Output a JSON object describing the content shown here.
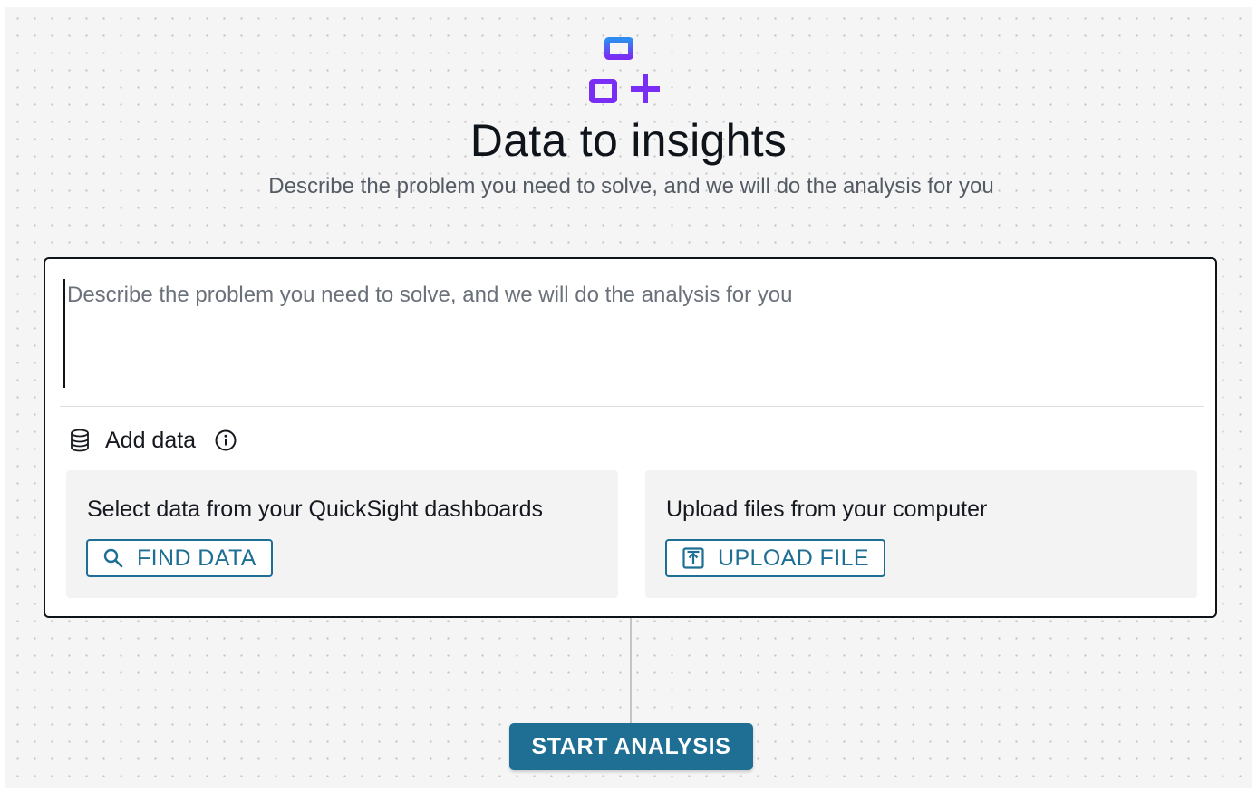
{
  "hero": {
    "icon": "workflow-add-icon",
    "title": "Data to insights",
    "subtitle": "Describe the problem you need to solve, and we will do the analysis for you"
  },
  "prompt": {
    "value": "",
    "placeholder": "Describe the problem you need to solve, and we will do the analysis for you"
  },
  "add_data": {
    "icon": "database-icon",
    "label": "Add data",
    "info_icon": "info-icon"
  },
  "sources": {
    "dashboards": {
      "title": "Select data from your QuickSight dashboards",
      "button_icon": "search-icon",
      "button_label": "FIND DATA"
    },
    "upload": {
      "title": "Upload files from your computer",
      "button_icon": "upload-icon",
      "button_label": "UPLOAD FILE"
    }
  },
  "actions": {
    "start_label": "START ANALYSIS"
  },
  "colors": {
    "accent": "#1f6f94",
    "icon_gradient_top": "#2e8cf0",
    "icon_gradient_bottom": "#7a2df5"
  }
}
